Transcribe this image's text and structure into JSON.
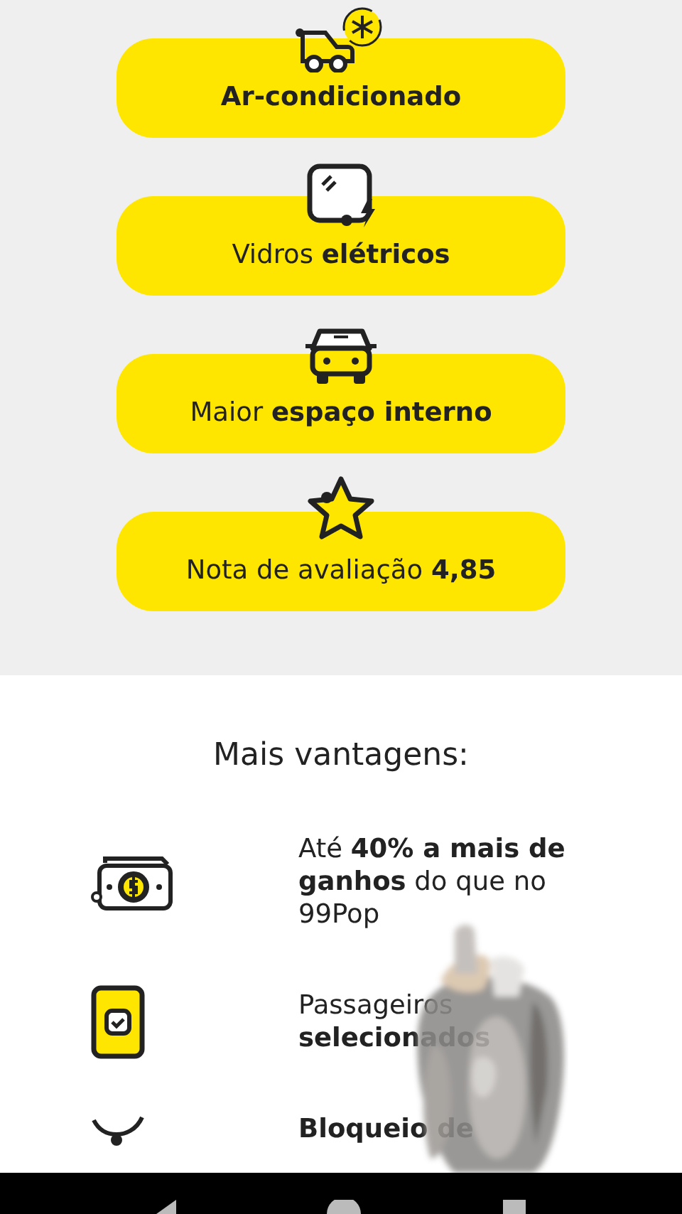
{
  "features": [
    {
      "label": "**Ar-condicionado**"
    },
    {
      "label": "Vidros **elétricos**"
    },
    {
      "label": "Maior **espaço interno**"
    },
    {
      "label": "Nota de avaliação **4,85**"
    }
  ],
  "advantages": {
    "title": "Mais vantagens:",
    "items": [
      {
        "text": "Até **40% a mais de ganhos** do que no 99Pop"
      },
      {
        "text": "Passageiros **selecionados**"
      },
      {
        "text": "**Bloqueio de**"
      }
    ]
  }
}
